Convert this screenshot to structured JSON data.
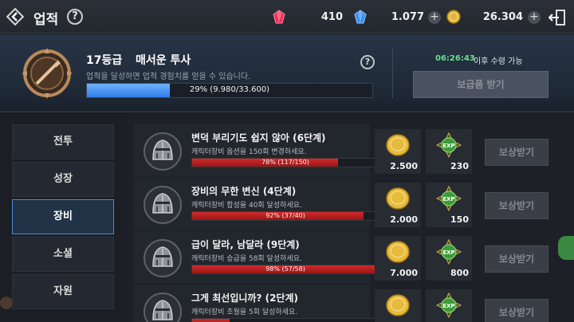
{
  "header": {
    "title": "업적",
    "help_label": "?",
    "currencies": [
      {
        "icon": "red-gem-icon",
        "value": "410",
        "color": "#e8345a"
      },
      {
        "icon": "blue-gem-icon",
        "value": "1.077",
        "color": "#3a8df0"
      },
      {
        "icon": "gold-coin-icon",
        "value": "26.304",
        "color": "#e2b33a"
      }
    ],
    "plus_label": "+"
  },
  "rank": {
    "level": "17등급",
    "title": "매서운 투사",
    "description": "업적을 달성하면 업적 경험치를 얻을 수 있습니다.",
    "help_label": "?",
    "progress_text": "29% (9.980/33.600)",
    "progress_percent": 29,
    "timer": "06:26:43",
    "timer_note": "이후 수령 가능",
    "reward_button": "보급품 받기"
  },
  "sidebar": {
    "tabs": [
      {
        "label": "전투",
        "active": false
      },
      {
        "label": "성장",
        "active": false
      },
      {
        "label": "장비",
        "active": true
      },
      {
        "label": "소셜",
        "active": false
      },
      {
        "label": "자원",
        "active": false
      }
    ]
  },
  "achievements": [
    {
      "title": "변덕 부리기도 쉽지 않아 (6단계)",
      "desc": "캐릭터장비 옵션을 150회 변경하세요.",
      "progress_text": "78% (117/150)",
      "percent": 78,
      "gold": "2.500",
      "exp": "230",
      "claim": "보상받기"
    },
    {
      "title": "장비의 무한 변신 (4단계)",
      "desc": "캐릭터장비 합성을 40회 달성하세요.",
      "progress_text": "92% (37/40)",
      "percent": 92,
      "gold": "2.000",
      "exp": "150",
      "claim": "보상받기"
    },
    {
      "title": "급이 달라, 남달라 (9단계)",
      "desc": "캐릭터장비 승급을 58회 달성하세요.",
      "progress_text": "98% (57/58)",
      "percent": 98,
      "gold": "7.000",
      "exp": "800",
      "claim": "보상받기"
    },
    {
      "title": "그게 최선입니까? (2단계)",
      "desc": "캐릭터장비 초월을 5회 달성하세요.",
      "progress_text": "",
      "percent": 20,
      "gold": "",
      "exp": "",
      "claim": "보상받기"
    }
  ],
  "reward_icons": {
    "gold": "gold-coin-icon",
    "exp": "exp-gem-icon",
    "exp_label": "EXP"
  }
}
